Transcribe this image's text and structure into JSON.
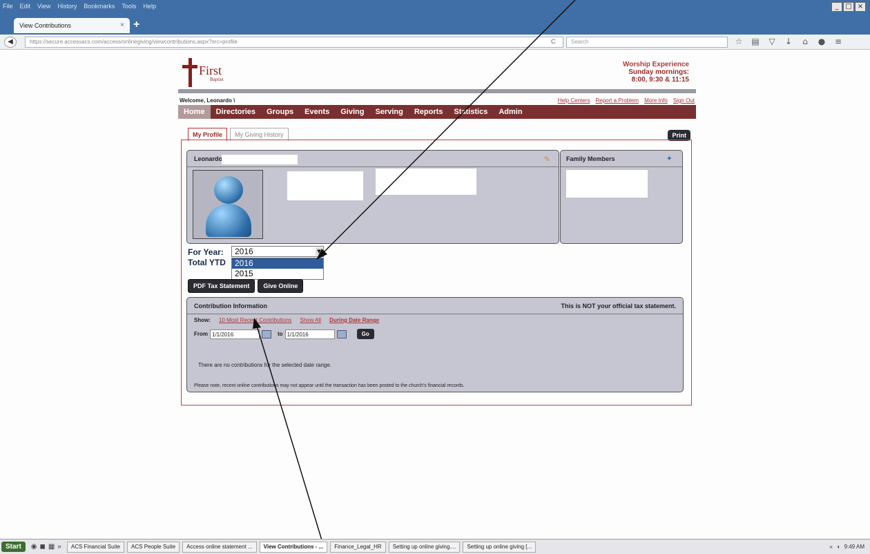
{
  "browser": {
    "menu": [
      "File",
      "Edit",
      "View",
      "History",
      "Bookmarks",
      "Tools",
      "Help"
    ],
    "window_controls": [
      "_",
      "□",
      "×"
    ],
    "tab_title": "View Contributions",
    "url": "https://secure.accessacs.com/access/onlinegiving/viewcontributions.aspx?src=profile",
    "search_placeholder": "Search"
  },
  "site": {
    "logo_name": "First",
    "logo_sub": "Baptist",
    "worship": [
      "Worship Experience",
      "Sunday mornings:",
      "8:00, 9:30 & 11:15"
    ],
    "welcome": "Welcome, Leonardo \\",
    "top_links": [
      "Help Centers",
      "Report a Problem",
      "More Info",
      "Sign Out"
    ],
    "nav": [
      "Home",
      "Directories",
      "Groups",
      "Events",
      "Giving",
      "Serving",
      "Reports",
      "Statistics",
      "Admin"
    ]
  },
  "profile_tabs": [
    "My Profile",
    "My Giving History"
  ],
  "print_label": "Print",
  "profile": {
    "name": "Leonardo"
  },
  "family": {
    "title": "Family Members"
  },
  "year": {
    "label": "For Year:",
    "selected": "2016",
    "total_label": "Total YTD",
    "options": [
      "2016",
      "2015"
    ]
  },
  "buttons": {
    "pdf": "PDF Tax Statement",
    "give": "Give Online"
  },
  "contribution": {
    "title": "Contribution Information",
    "notice": "This is NOT your official tax statement.",
    "show_label": "Show:",
    "show_links": [
      "10 Most Recent Contributions",
      "Show All",
      "During Date Range"
    ],
    "from_label": "From",
    "from_value": "1/1/2016",
    "to_label": "to",
    "to_value": "1/1/2016",
    "go_label": "Go",
    "empty": "There are no contributions for the selected date range.",
    "note": "Please note, recent online contributions may not appear until the transaction has been posted to the church's financial records."
  },
  "taskbar": {
    "start": "Start",
    "tasks": [
      "ACS Financial Suite",
      "ACS People Suite",
      "Access online statement ...",
      "View Contributions - ...",
      "Finance_Legal_HR",
      "Setting up online giving....",
      "Setting up online giving [..."
    ],
    "clock": "9:49 AM"
  }
}
